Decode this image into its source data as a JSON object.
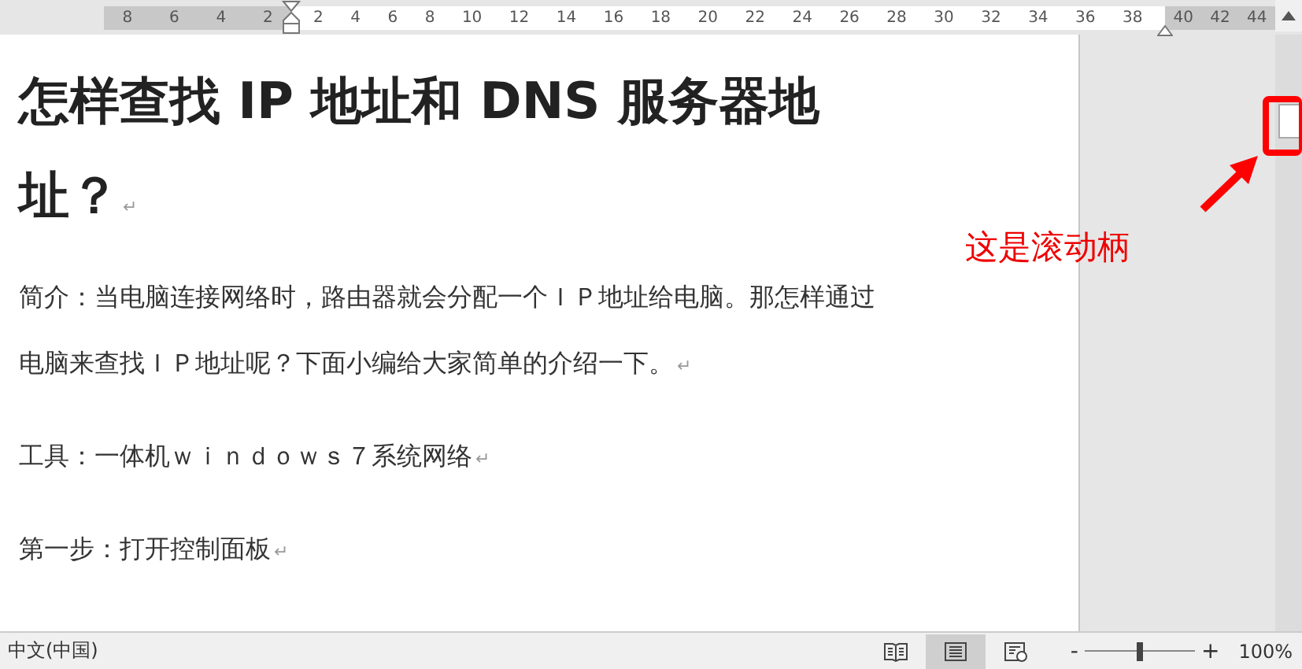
{
  "ruler": {
    "left_numbers": [
      "8",
      "6",
      "4",
      "2"
    ],
    "main_numbers": [
      "2",
      "4",
      "6",
      "8",
      "10",
      "12",
      "14",
      "16",
      "18",
      "20",
      "22",
      "24",
      "26",
      "28",
      "30",
      "32",
      "34",
      "36",
      "38"
    ],
    "right_numbers": [
      "40",
      "42",
      "44"
    ]
  },
  "document": {
    "heading_lines": [
      "怎样查找 IP 地址和 DNS 服务器地",
      "址？"
    ],
    "heading_mark": "↵",
    "paragraphs": [
      {
        "lines": [
          "简介：当电脑连接网络时，路由器就会分配一个ＩＰ地址给电脑。那怎样通过",
          "电脑来查找ＩＰ地址呢？下面小编给大家简单的介绍一下。"
        ],
        "mark": "↵"
      },
      {
        "lines": [
          "工具：一体机ｗｉｎｄｏｗｓ７系统网络"
        ],
        "mark": "↵"
      },
      {
        "lines": [
          "第一步：打开控制面板"
        ],
        "mark": "↵"
      }
    ]
  },
  "annotation": {
    "text": "这是滚动柄"
  },
  "status_bar": {
    "language": "中文(中国)",
    "views": [
      {
        "kind": "read",
        "selected": false
      },
      {
        "kind": "print",
        "selected": true
      },
      {
        "kind": "web",
        "selected": false
      }
    ],
    "zoom_minus": "-",
    "zoom_slider": {
      "level": 0.5
    },
    "zoom_plus": "+",
    "zoom": "100%"
  }
}
